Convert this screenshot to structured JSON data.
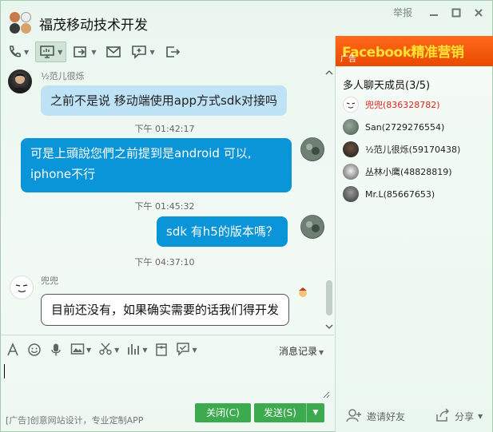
{
  "window": {
    "title": "福茂移动技术开发",
    "report_label": "举报",
    "minimize_glyph": "—",
    "maximize_glyph": "☐",
    "close_glyph": "✕"
  },
  "toolbar": {
    "items": [
      "phone-icon",
      "screen-share-icon",
      "file-transfer-icon",
      "mail-icon",
      "add-app-icon",
      "exit-group-icon"
    ]
  },
  "messages": [
    {
      "sender": "½范儿很烁",
      "text": "之前不是说 移动端使用app方式sdk对接吗",
      "direction": "in"
    },
    {
      "time": "下午 01:42:17"
    },
    {
      "text": "可是上頭說您們之前提到是android 可以,",
      "text2": "iphone不行",
      "direction": "out"
    },
    {
      "time": "下午 01:45:32"
    },
    {
      "text": "sdk 有h5的版本嗎？",
      "direction": "out"
    },
    {
      "time": "下午 04:37:10"
    },
    {
      "sender": "兜兜",
      "text": "目前还没有，如果确实需要的话我们得开发",
      "direction": "in"
    }
  ],
  "input": {
    "history_label": "消息记录",
    "value": "",
    "ad_text": "[广告]创意网站设计，专业定制APP",
    "close_label": "关闭(C)",
    "send_label": "发送(S)"
  },
  "right_panel": {
    "banner_text": "Facebook精准营销",
    "banner_ad": "广告",
    "members_title": "多人聊天成员(3/5)",
    "members": [
      {
        "name": "兜兜(836328782)",
        "owner": true
      },
      {
        "name": "San(2729276554)",
        "owner": false
      },
      {
        "name": "½范儿很烁(59170438)",
        "owner": false
      },
      {
        "name": "丛林小鹰(48828819)",
        "owner": false
      },
      {
        "name": "Mr.L(85667653)",
        "owner": false
      }
    ],
    "invite_label": "邀请好友",
    "share_label": "分享"
  },
  "colors": {
    "out_bubble": "#0a95d8",
    "in_bubble": "#bfe3f6",
    "button_green": "#3daa4f",
    "owner_red": "#e0241c"
  }
}
